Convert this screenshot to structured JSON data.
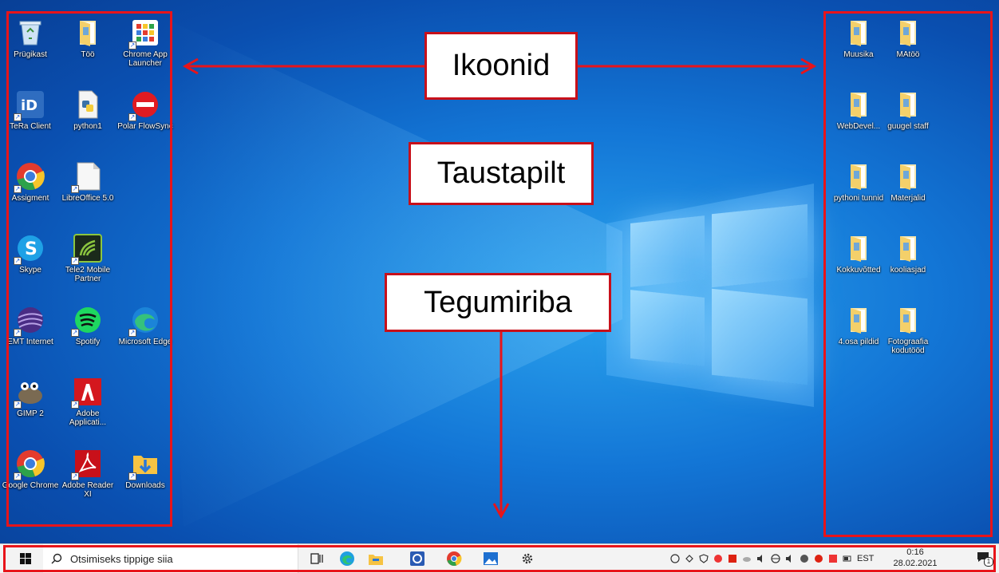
{
  "annotations": {
    "icons_label": "Ikoonid",
    "wallpaper_label": "Taustapilt",
    "taskbar_label": "Tegumiriba"
  },
  "desktop_left": [
    {
      "name": "Prügikast",
      "icon": "recycle-bin-icon"
    },
    {
      "name": "Töö",
      "icon": "folder-icon"
    },
    {
      "name": "Chrome App Launcher",
      "icon": "app-launcher-icon"
    },
    {
      "name": "TeRa Client",
      "icon": "tera-icon"
    },
    {
      "name": "python1",
      "icon": "python-file-icon"
    },
    {
      "name": "Polar FlowSync",
      "icon": "polar-icon"
    },
    {
      "name": "Assigment",
      "icon": "chrome-icon"
    },
    {
      "name": "LibreOffice 5.0",
      "icon": "libreoffice-icon"
    },
    {
      "name": "Skype",
      "icon": "skype-icon"
    },
    {
      "name": "Tele2 Mobile Partner",
      "icon": "tele2-icon"
    },
    {
      "name": "EMT Internet",
      "icon": "emt-icon"
    },
    {
      "name": "Spotify",
      "icon": "spotify-icon"
    },
    {
      "name": "Microsoft Edge",
      "icon": "edge-icon"
    },
    {
      "name": "GIMP 2",
      "icon": "gimp-icon"
    },
    {
      "name": "Adobe Applicati...",
      "icon": "adobe-icon"
    },
    {
      "name": "Google Chrome",
      "icon": "chrome-icon"
    },
    {
      "name": "Adobe Reader XI",
      "icon": "acrobat-icon"
    },
    {
      "name": "Downloads",
      "icon": "downloads-folder-icon"
    }
  ],
  "desktop_right": [
    {
      "name": "Muusika",
      "icon": "folder-icon"
    },
    {
      "name": "MAtöö",
      "icon": "folder-icon"
    },
    {
      "name": "WebDevel...",
      "icon": "folder-icon"
    },
    {
      "name": "guugel staff",
      "icon": "folder-icon"
    },
    {
      "name": "pythoni tunnid",
      "icon": "folder-icon"
    },
    {
      "name": "Materjalid",
      "icon": "folder-icon"
    },
    {
      "name": "Kokkuvõtted",
      "icon": "folder-icon"
    },
    {
      "name": "kooliasjad",
      "icon": "folder-icon"
    },
    {
      "name": "4.osa pildid",
      "icon": "folder-icon"
    },
    {
      "name": "Fotograafia kodutööd",
      "icon": "folder-icon"
    }
  ],
  "taskbar": {
    "search_placeholder": "Otsimiseks tippige siia",
    "language": "EST",
    "time": "0:16",
    "date": "28.02.2021",
    "notification_count": "1",
    "pinned": [
      "task-view-icon",
      "edge-icon",
      "file-explorer-icon",
      "outlook-icon",
      "chrome-icon",
      "photos-icon",
      "settings-icon"
    ]
  },
  "colors": {
    "accent_red": "#e8141a",
    "wallpaper_blue": "#1376d6",
    "taskbar_bg": "#f3f3f3"
  }
}
